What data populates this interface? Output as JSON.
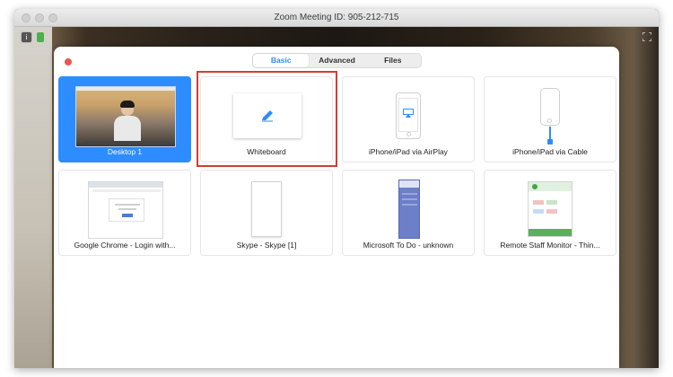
{
  "window": {
    "title": "Zoom Meeting ID: 905-212-715"
  },
  "toolbar_icons": {
    "info": "info-icon",
    "lock": "lock-icon",
    "fullscreen": "fullscreen-icon"
  },
  "tabs": [
    {
      "label": "Basic",
      "active": true
    },
    {
      "label": "Advanced",
      "active": false
    },
    {
      "label": "Files",
      "active": false
    }
  ],
  "share_options": [
    {
      "label": "Desktop 1",
      "selected": true
    },
    {
      "label": "Whiteboard",
      "selected": false,
      "highlighted": true
    },
    {
      "label": "iPhone/iPad via AirPlay",
      "selected": false
    },
    {
      "label": "iPhone/iPad via Cable",
      "selected": false
    },
    {
      "label": "Google Chrome - Login with...",
      "selected": false
    },
    {
      "label": "Skype - Skype [1]",
      "selected": false
    },
    {
      "label": "Microsoft To Do - unknown",
      "selected": false
    },
    {
      "label": "Remote Staff Monitor - Thin...",
      "selected": false
    }
  ],
  "colors": {
    "accent": "#2d8cff",
    "highlight": "#d43d2f",
    "close": "#e8584e"
  },
  "info_badge_text": "i"
}
